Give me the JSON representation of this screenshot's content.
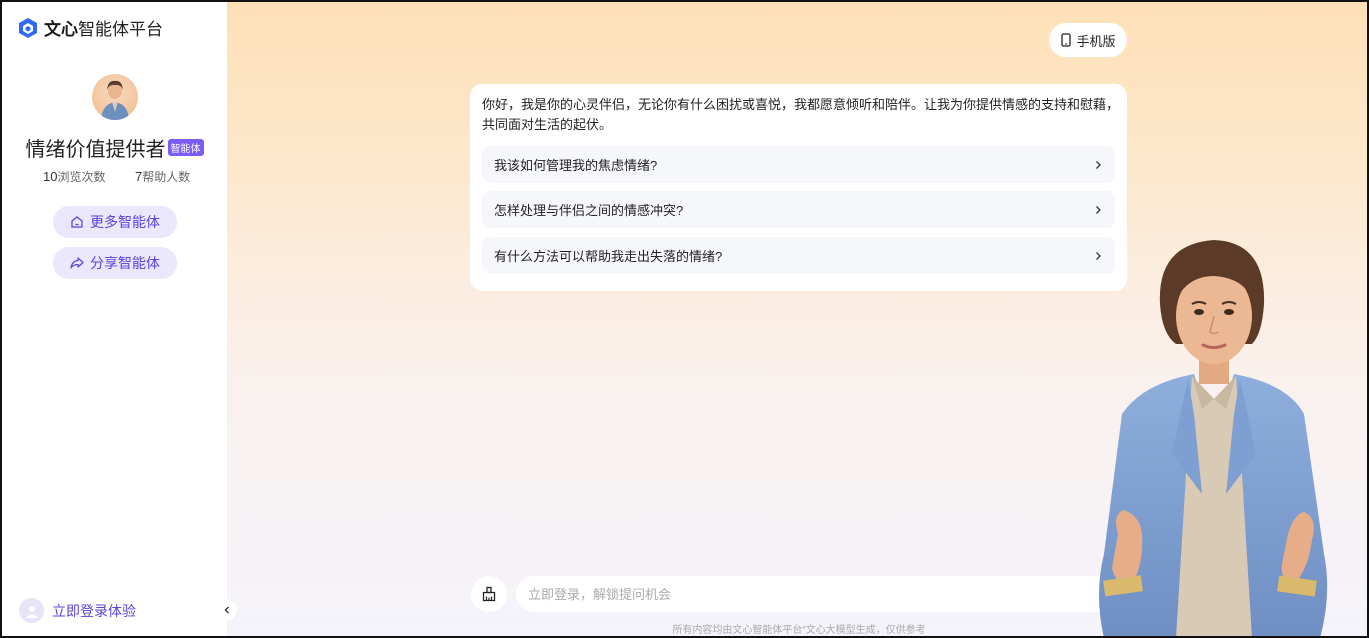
{
  "app": {
    "logo_brand": "文心",
    "logo_rest": "智能体平台"
  },
  "sidebar": {
    "bot_name": "情绪价值提供者",
    "badge": "智能体",
    "views_count": "10",
    "views_label": "浏览次数",
    "helped_count": "7",
    "helped_label": "帮助人数",
    "more_agents": "更多智能体",
    "share_agent": "分享智能体",
    "login": "立即登录体验"
  },
  "header": {
    "mobile_label": "手机版"
  },
  "chat": {
    "greeting": "你好，我是你的心灵伴侣，无论你有什么困扰或喜悦，我都愿意倾听和陪伴。让我为你提供情感的支持和慰藉，共同面对生活的起伏。",
    "questions": [
      "我该如何管理我的焦虑情绪?",
      "怎样处理与伴侣之间的情感冲突?",
      "有什么方法可以帮助我走出失落的情绪?"
    ]
  },
  "input": {
    "placeholder": "立即登录，解锁提问机会"
  },
  "footer": {
    "disclaimer": "所有内容均由文心智能体平台“文心大模型生成，仅供参考"
  },
  "colors": {
    "accent": "#5a44d9",
    "badge": "#7b5cf5",
    "pill_bg": "#ebe7fd"
  }
}
